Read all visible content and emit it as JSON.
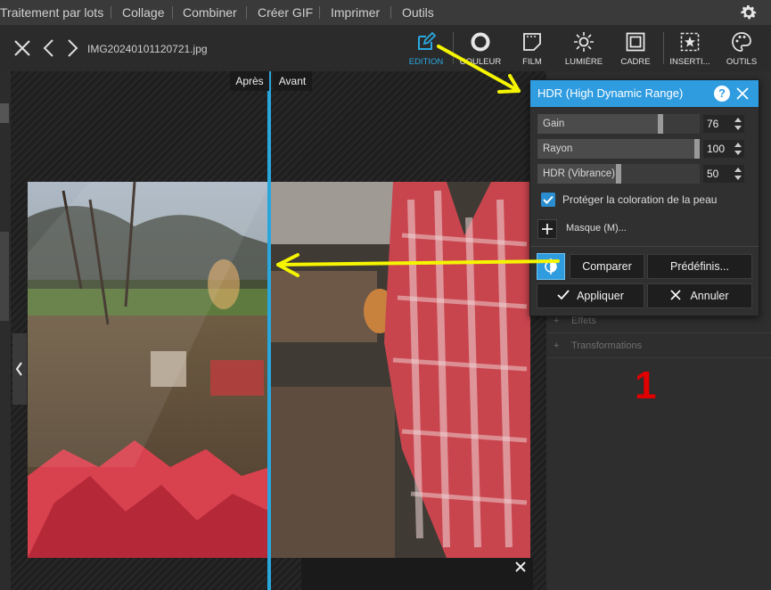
{
  "menu": {
    "items": [
      "Traitement par lots",
      "Collage",
      "Combiner",
      "Créer GIF",
      "Imprimer",
      "Outils"
    ]
  },
  "toolbar": {
    "filename": "IMG20240101120721.jpg",
    "tools": [
      {
        "label": "EDITION",
        "icon": "pencil-square-icon",
        "active": true
      },
      {
        "label": "COULEUR",
        "icon": "color-circle-icon"
      },
      {
        "label": "FILM",
        "icon": "film-icon"
      },
      {
        "label": "LUMIÈRE",
        "icon": "sun-icon"
      },
      {
        "label": "CADRE",
        "icon": "frame-icon"
      },
      {
        "label": "INSERTI...",
        "icon": "insert-star-icon"
      },
      {
        "label": "OUTILS",
        "icon": "palette-icon"
      }
    ]
  },
  "compare": {
    "after_label": "Après",
    "before_label": "Avant"
  },
  "dialog": {
    "title": "HDR (High Dynamic Range)",
    "help": "?",
    "sliders": [
      {
        "name": "Gain",
        "value": "76",
        "level": 0.76
      },
      {
        "name": "Rayon",
        "value": "100",
        "level": 1.0
      },
      {
        "name": "HDR (Vibrance)",
        "value": "50",
        "level": 0.5
      }
    ],
    "skin_checkbox": {
      "label": "Protéger la coloration de la peau",
      "checked": true
    },
    "mask_label": "Masque (M)...",
    "buttons": {
      "compare": "Comparer",
      "presets": "Prédéfinis...",
      "apply": "Appliquer",
      "cancel": "Annuler"
    }
  },
  "side_panel": {
    "rows": [
      "Effets",
      "Transformations"
    ]
  },
  "annotation": {
    "number": "1",
    "arrow_color": "#f5f500",
    "number_color": "#e00000"
  },
  "colors": {
    "accent": "#2f9ce0",
    "divider": "#29a6dc"
  }
}
